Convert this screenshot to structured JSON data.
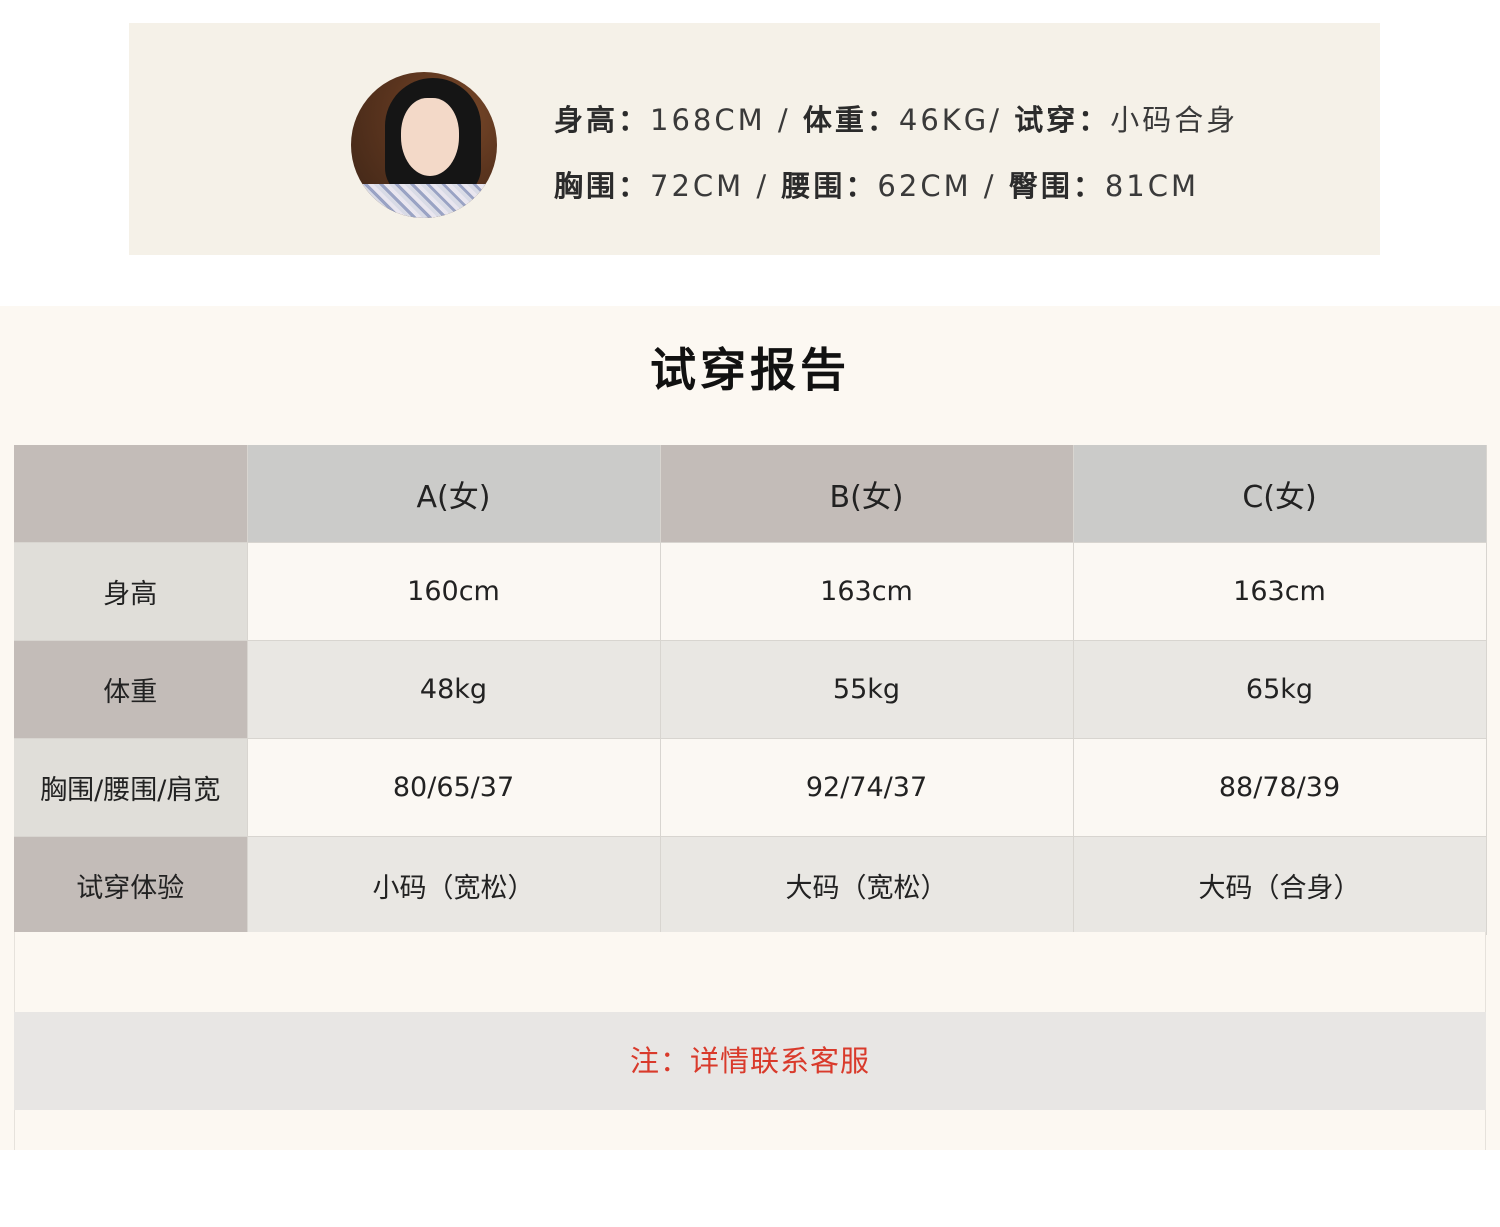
{
  "model": {
    "line1": {
      "height_label": "身高：",
      "height_value": "168CM / ",
      "weight_label": "体重：",
      "weight_value": "46KG/ ",
      "tryon_label": "试穿：",
      "tryon_value": "小码合身"
    },
    "line2": {
      "bust_label": "胸围：",
      "bust_value": "72CM / ",
      "waist_label": "腰围：",
      "waist_value": "62CM / ",
      "hip_label": "臀围：",
      "hip_value": "81CM"
    }
  },
  "report": {
    "title": "试穿报告",
    "columns": [
      "",
      "A(女)",
      "B(女)",
      "C(女)"
    ],
    "rows": [
      {
        "label": "身高",
        "values": [
          "160cm",
          "163cm",
          "163cm"
        ]
      },
      {
        "label": "体重",
        "values": [
          "48kg",
          "55kg",
          "65kg"
        ]
      },
      {
        "label": "胸围/腰围/肩宽",
        "values": [
          "80/65/37",
          "92/74/37",
          "88/78/39"
        ]
      },
      {
        "label": "试穿体验",
        "values": [
          "小码（宽松）",
          "大码（宽松）",
          "大码（合身）"
        ]
      }
    ],
    "note": "注：详情联系客服"
  },
  "colors": {
    "card_bg": "#f5f1e8",
    "section_bg": "#fcf8f2",
    "header_taupe": "#c3bcb8",
    "header_grey": "#cbcbc9",
    "note_red": "#d93a2b"
  }
}
